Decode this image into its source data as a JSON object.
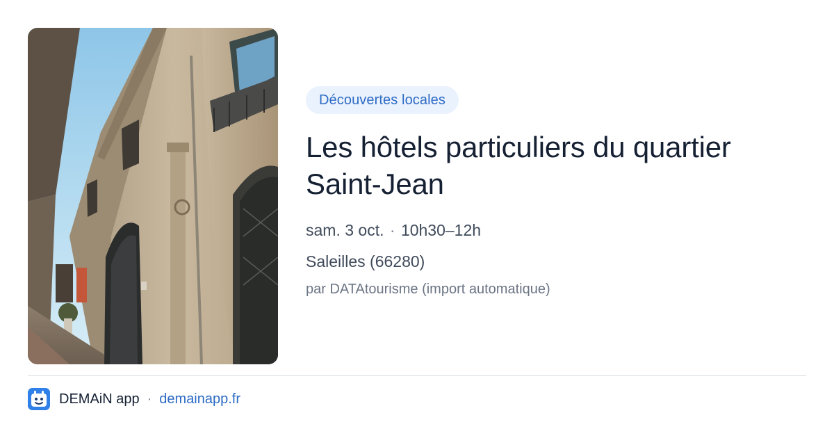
{
  "card": {
    "category": "Découvertes locales",
    "title_line_1": "Les hôtels particuliers du quartier",
    "title_line_2": "Saint-Jean",
    "date": "sam. 3 oct.",
    "separator": "·",
    "time": "10h30–12h",
    "location": "Saleilles (66280)",
    "source": "par DATAtourisme (import automatique)"
  },
  "photo": {
    "subject": "street-with-historic-townhouses-photo"
  },
  "footer": {
    "app_name": "DEMAiN app",
    "separator": "·",
    "site": "demainapp.fr",
    "logo_icon": "calendar-face-icon"
  },
  "colors": {
    "accent": "#2d6bc5",
    "pill_background": "#eaf2fd",
    "title": "#152033",
    "meta": "#3f4a5a",
    "muted": "#6b7484",
    "logo": "#2f80e8"
  }
}
